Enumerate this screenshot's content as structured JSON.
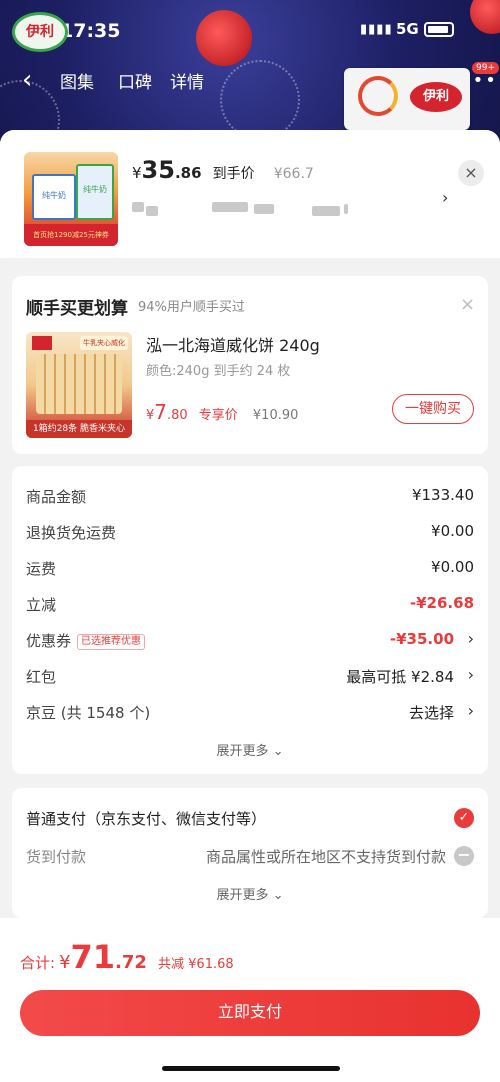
{
  "status_bar": {
    "time": "17:35",
    "network": "5G"
  },
  "top_nav": {
    "brand": "伊利",
    "tabs": [
      "图集",
      "口碑",
      "详情"
    ],
    "cart_badge": "99+",
    "olympic_logo": "伊利"
  },
  "product": {
    "price_symbol": "¥",
    "price_int": "35",
    "price_dec": ".86",
    "price_label": "到手价",
    "original_price": "¥66.7",
    "thumb_caption": "首页抢1290减25元神券",
    "thumb_box1": "纯牛奶",
    "thumb_box2": "纯牛奶"
  },
  "recommend": {
    "title": "顺手买更划算",
    "subtitle": "94%用户顺手买过",
    "name": "泓一北海道威化饼 240g",
    "spec": "颜色:240g 到手约 24 枚",
    "price_symbol": "¥",
    "price_int": "7",
    "price_dec": ".80",
    "price_tag": "专享价",
    "original_price": "¥10.90",
    "buy_label": "一键购买",
    "thumb_label": "1箱约28条 脆香米夹心",
    "thumb_header": "牛乳夹心威化"
  },
  "fees": {
    "rows": [
      {
        "label": "商品金额",
        "value": "¥133.40"
      },
      {
        "label": "退换货免运费",
        "value": "¥0.00"
      },
      {
        "label": "运费",
        "value": "¥0.00"
      },
      {
        "label": "立减",
        "value": "-¥26.68"
      },
      {
        "label": "优惠券",
        "tag": "已选推荐优惠",
        "value": "-¥35.00"
      },
      {
        "label": "红包",
        "value": "最高可抵 ¥2.84"
      },
      {
        "label": "京豆 (共 1548 个)",
        "value": "去选择"
      }
    ],
    "expand_label": "展开更多"
  },
  "payment": {
    "normal": "普通支付（京东支付、微信支付等）",
    "cod_label": "货到付款",
    "cod_note": "商品属性或所在地区不支持货到付款",
    "expand_label": "展开更多"
  },
  "bottom": {
    "total_label": "合计:",
    "total_symbol": "¥",
    "total_int": "71",
    "total_dec": ".72",
    "saved": "共减 ¥61.68",
    "pay_button": "立即支付"
  },
  "colors": {
    "accent": "#e93b3b",
    "background": "#f2f2f2"
  }
}
